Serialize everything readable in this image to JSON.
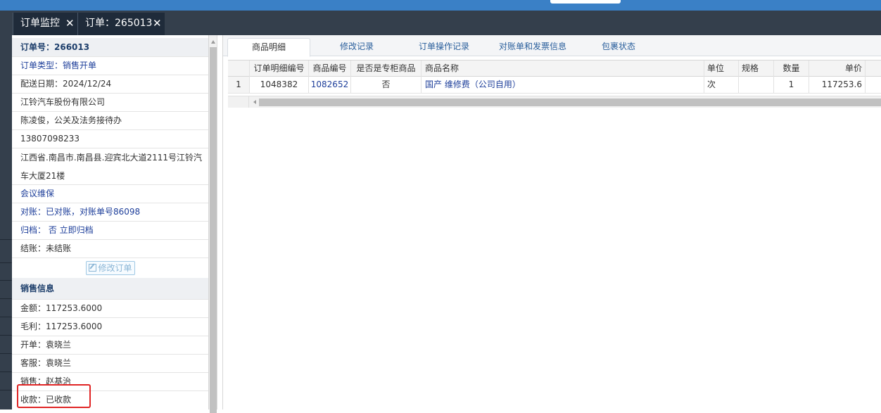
{
  "tabs": [
    {
      "label": "订单监控",
      "close": "✕"
    },
    {
      "label": "订单：265013",
      "close": "✕"
    }
  ],
  "order": {
    "number": "订单号：266013",
    "type": "订单类型：销售开单",
    "delivery_date": "配送日期：2024/12/24",
    "company": "江铃汽车股份有限公司",
    "contact": "陈凌俊，公关及法务接待办",
    "phone": "13807098233",
    "address_line1": "江西省.南昌市.南昌县.迎宾北大道2111号江铃汽",
    "address_line2": "车大厦21楼",
    "note": "会议维保",
    "reconciliation": "对账：已对账，对账单号86098",
    "archive": "归档： 否 立即归档",
    "settlement": "结账：未结账",
    "edit_button": "修改订单"
  },
  "sales": {
    "section_title": "销售信息",
    "amount": "金额：117253.6000",
    "gross_profit": "毛利：117253.6000",
    "issuer": "开单：袁晓兰",
    "service": "客服：袁晓兰",
    "salesperson": "销售：赵基治",
    "payment": "收款：已收款"
  },
  "subtabs": [
    "商品明细",
    "修改记录",
    "订单操作记录",
    "对账单和发票信息",
    "包裹状态"
  ],
  "grid": {
    "columns": [
      "订单明细编号",
      "商品编号",
      "是否是专柜商品",
      "商品名称",
      "单位",
      "规格",
      "数量",
      "单价"
    ],
    "rows": [
      {
        "index": "1",
        "detail_no": "1048382",
        "product_no": "1082652",
        "counter": "否",
        "name": "国产 维修费（公司自用）",
        "unit": "次",
        "spec": "",
        "qty": "1",
        "price": "117253.6"
      }
    ]
  },
  "colors": {
    "topbar": "#3a80c6",
    "tabstrip": "#343f4c",
    "highlight": "#e02525",
    "link": "#1d3e9a"
  }
}
